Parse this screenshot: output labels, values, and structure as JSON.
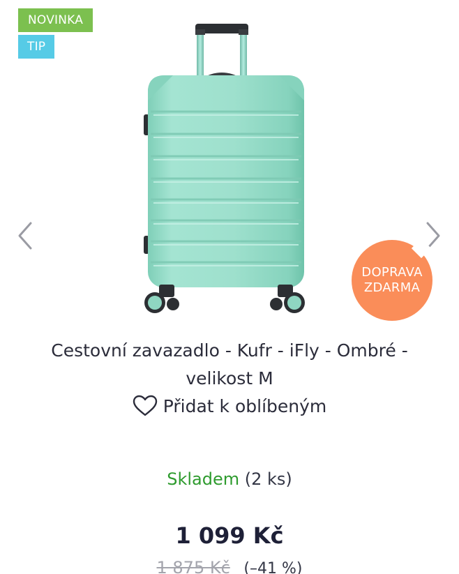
{
  "badges": {
    "new": "NOVINKA",
    "tip": "TIP"
  },
  "gallery": {
    "image_alt": "iFly Ombré suitcase, mint",
    "prev_icon": "chevron-left-icon",
    "next_icon": "chevron-right-icon"
  },
  "shipping_badge": {
    "line1": "DOPRAVA",
    "line2": "ZDARMA"
  },
  "product": {
    "title_line1": "Cestovní zavazadlo - Kufr - iFly - Ombré -",
    "title_line2": "velikost M",
    "favorite_label": "Přidat k oblíbeným",
    "favorite_icon": "heart-icon"
  },
  "availability": {
    "status": "Skladem",
    "quantity": "(2 ks)"
  },
  "pricing": {
    "price": "1 099 Kč",
    "old_price": "1 875 Kč",
    "discount": "(–41 %)"
  },
  "colors": {
    "badge_new": "#7cc04f",
    "badge_tip": "#56cbe6",
    "shipping_badge": "#fa8d59",
    "in_stock": "#2e9b2e",
    "suitcase": "#98dec9"
  }
}
